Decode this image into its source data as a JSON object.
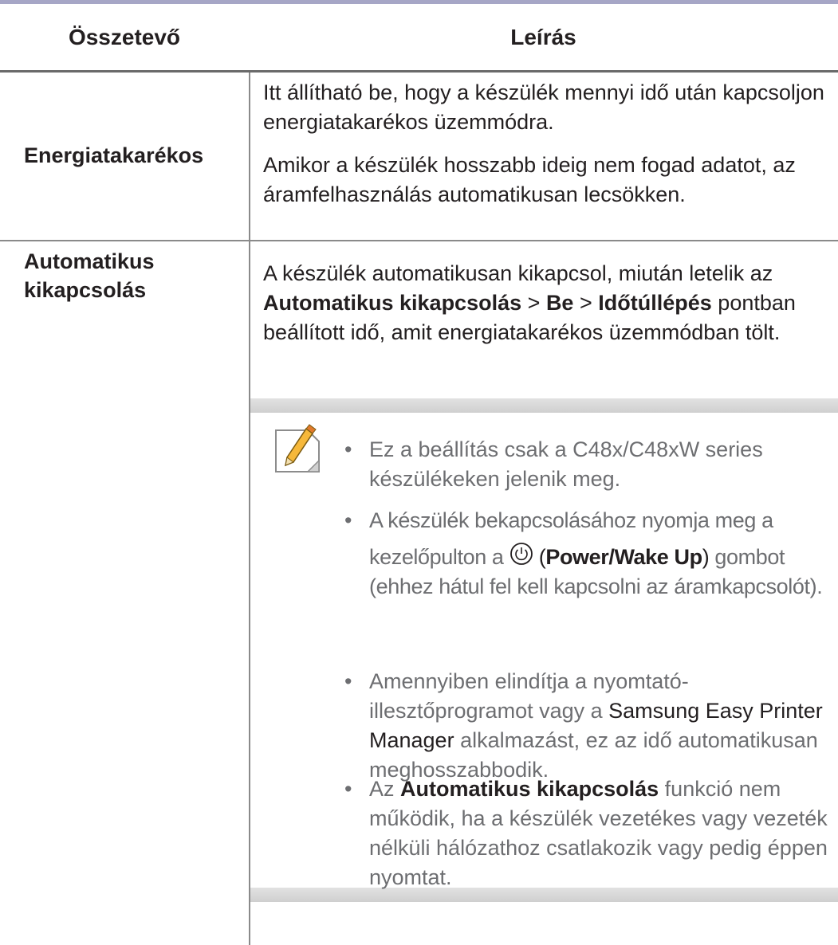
{
  "table": {
    "header": {
      "col1": "Összetevő",
      "col2": "Leírás"
    },
    "rows": [
      {
        "label": "Energiatakarékos",
        "paragraphs": [
          "Itt állítható be, hogy a készülék mennyi idő után kapcsoljon energiatakarékos üzemmódra.",
          "Amikor a készülék hosszabb ideig nem fogad adatot, az áramfelhasználás automatikusan lecsökken."
        ]
      },
      {
        "label_line1": "Automatikus",
        "label_line2": "kikapcsolás",
        "intro": {
          "before": "A készülék automatikusan kikapcsol, miután letelik az",
          "b1": "Automatikus kikapcsolás",
          "sep1": ">",
          "b2": "Be",
          "sep2": ">",
          "b3": "Időtúllépés",
          "after": "pontban beállított idő, amit energiatakarékos üzemmódban tölt."
        },
        "notes": {
          "icon": "note-pencil-icon",
          "bullet": "•",
          "n1": "Ez a beállítás csak a C48x/C48xW series készülékeken jelenik meg.",
          "n2_a": "A készülék bekapcsolásához nyomja meg a",
          "n2_b": "kezelőpulton a",
          "n2_open": "(",
          "n2_bold": "Power/Wake Up",
          "n2_close": ")",
          "n2_c": "gombot (ehhez hátul fel kell kapcsolni az áramkapcsolót).",
          "n3_a": "Amennyiben elindítja a nyomtató-illesztőprogramot vagy a",
          "n3_app": "Samsung Easy Printer Manager",
          "n3_b": "alkalmazást, ez az idő automatikusan meghosszabbodik.",
          "n4_a": "Az",
          "n4_bold": "Automatikus kikapcsolás",
          "n4_b": "funkció nem működik, ha a készülék vezetékes vagy vezeték nélküli hálózathoz csatlakozik vagy pedig éppen nyomtat."
        }
      }
    ]
  }
}
